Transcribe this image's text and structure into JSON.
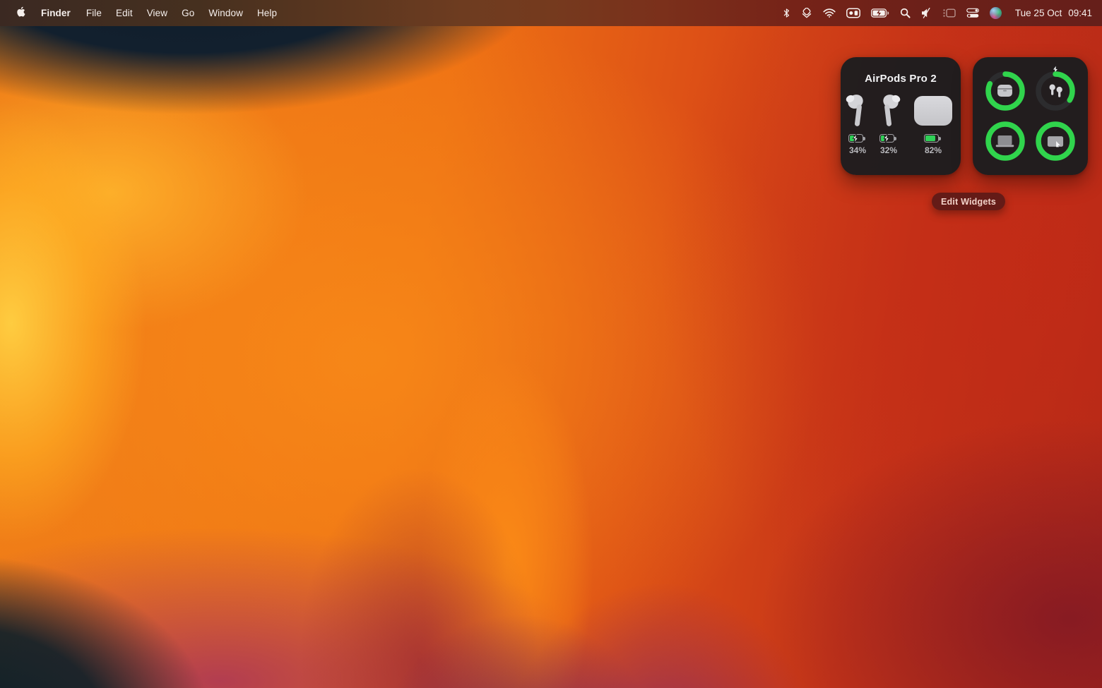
{
  "menu_bar": {
    "items": [
      "Finder",
      "File",
      "Edit",
      "View",
      "Go",
      "Window",
      "Help"
    ],
    "status_icons": [
      "bluetooth",
      "stacks",
      "wifi",
      "menubar-app",
      "battery-charging",
      "spotlight",
      "volume-muted",
      "stage-manager",
      "control-center",
      "siri"
    ],
    "clock": {
      "date": "Tue 25 Oct",
      "time": "09:41"
    }
  },
  "widgets": {
    "airpods": {
      "title": "AirPods Pro 2",
      "devices": [
        {
          "name": "left-earbud",
          "level": 34,
          "label": "34%",
          "charging": true
        },
        {
          "name": "right-earbud",
          "level": 32,
          "label": "32%",
          "charging": true
        },
        {
          "name": "case",
          "level": 82,
          "label": "82%",
          "charging": false
        }
      ]
    },
    "battery_rings": {
      "rings": [
        {
          "device": "airpods-case",
          "percent": 82,
          "charging": false
        },
        {
          "device": "airpods-earbuds",
          "percent": 34,
          "charging": true
        },
        {
          "device": "macbook",
          "percent": 100,
          "charging": false
        },
        {
          "device": "trackpad",
          "percent": 100,
          "charging": false
        }
      ]
    },
    "edit_widgets_label": "Edit Widgets"
  },
  "colors": {
    "ring_green": "#30d44c",
    "ring_track": "#2c2c2e",
    "battery_green": "#30d158",
    "widget_background": "#1d1d1f",
    "edit_button_background": "#5c1a18"
  }
}
